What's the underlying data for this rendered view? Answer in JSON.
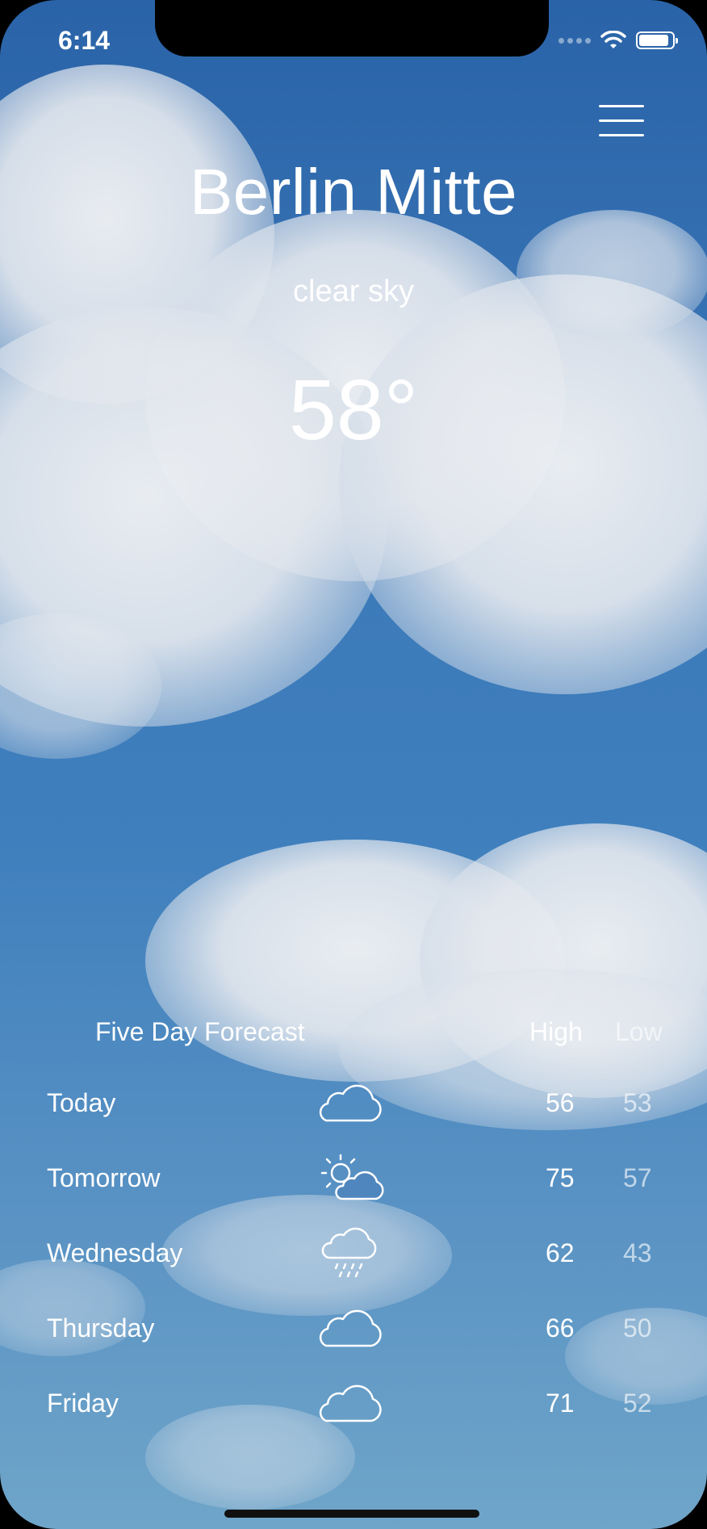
{
  "status_bar": {
    "time": "6:14",
    "battery_level": 0.9
  },
  "header": {
    "city": "Berlin Mitte",
    "description": "clear sky",
    "temperature": "58°"
  },
  "forecast": {
    "title": "Five Day Forecast",
    "high_label": "High",
    "low_label": "Low",
    "days": [
      {
        "day": "Today",
        "icon": "cloud-icon",
        "high": "56",
        "low": "53"
      },
      {
        "day": "Tomorrow",
        "icon": "partly-sunny-icon",
        "high": "75",
        "low": "57"
      },
      {
        "day": "Wednesday",
        "icon": "rain-icon",
        "high": "62",
        "low": "43"
      },
      {
        "day": "Thursday",
        "icon": "cloud-icon",
        "high": "66",
        "low": "50"
      },
      {
        "day": "Friday",
        "icon": "cloud-icon",
        "high": "71",
        "low": "52"
      }
    ]
  },
  "colors": {
    "sky_top": "#2a63a8",
    "sky_bottom": "#6fa5c9",
    "text": "#ffffff"
  }
}
